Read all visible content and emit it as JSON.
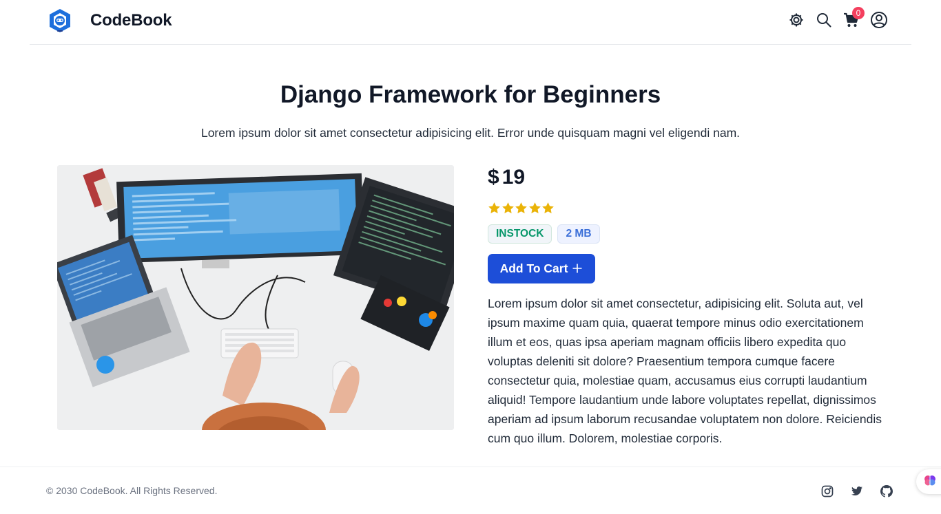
{
  "brand": {
    "name": "CodeBook",
    "logo_icon": "codebook-logo-icon"
  },
  "header": {
    "icons": [
      "gear-icon",
      "search-icon",
      "cart-icon",
      "user-icon"
    ],
    "cart_count": "0"
  },
  "product": {
    "title": "Django Framework for Beginners",
    "subtitle": "Lorem ipsum dolor sit amet consectetur adipisicing elit. Error unde quisquam magni vel eligendi nam.",
    "currency": "$",
    "price": "19",
    "rating": 5,
    "rating_max": 5,
    "stock_label": "INSTOCK",
    "size_label": "2 MB",
    "add_to_cart_label": "Add To Cart",
    "description": "Lorem ipsum dolor sit amet consectetur, adipisicing elit. Soluta aut, vel ipsum maxime quam quia, quaerat tempore minus odio exercitationem illum et eos, quas ipsa aperiam magnam officiis libero expedita quo voluptas deleniti sit dolore? Praesentium tempora cumque facere consectetur quia, molestiae quam, accusamus eius corrupti laudantium aliquid! Tempore laudantium unde labore voluptates repellat, dignissimos aperiam ad ipsum laborum recusandae voluptatem non dolore. Reiciendis cum quo illum. Dolorem, molestiae corporis.",
    "image_icon": "developer-workspace-photo"
  },
  "footer": {
    "copyright": "© 2030 CodeBook. All Rights Reserved.",
    "social_icons": [
      "instagram-icon",
      "twitter-icon",
      "github-icon"
    ]
  },
  "colors": {
    "primary": "#1d4ed8",
    "star": "#eab308",
    "stock": "#059669",
    "badge_size": "#3b6fd8",
    "cart_badge": "#f43f5e"
  }
}
